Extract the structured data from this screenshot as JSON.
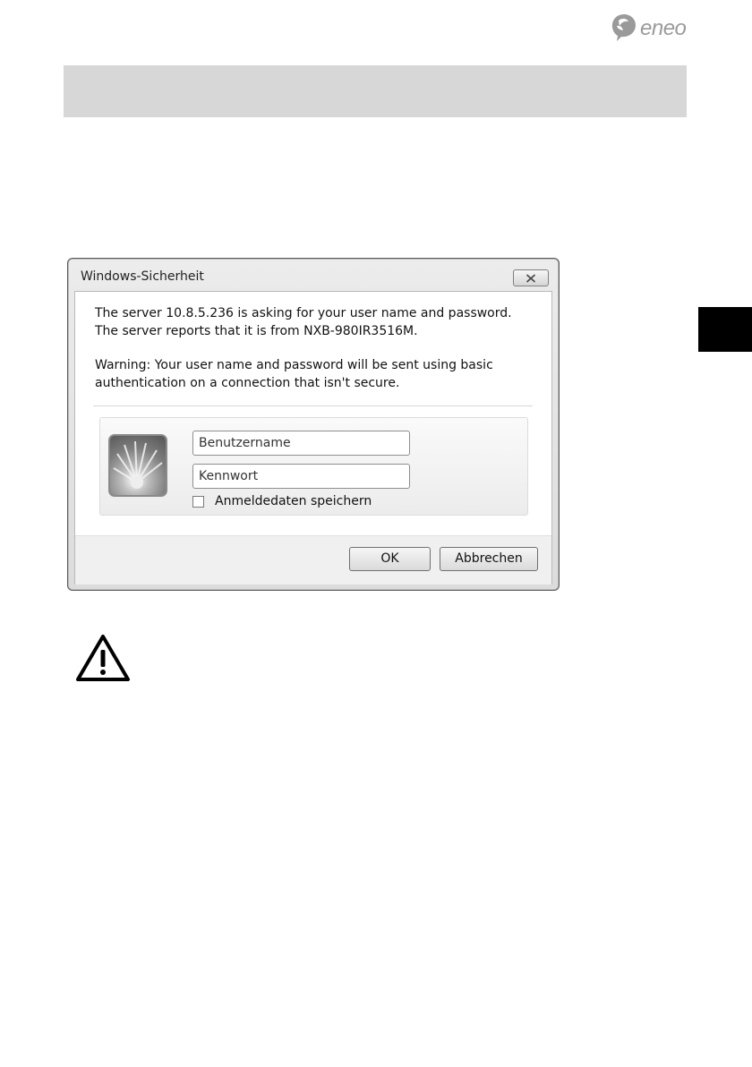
{
  "logo": {
    "text": "eneo"
  },
  "dialog": {
    "title": "Windows-Sicherheit",
    "message_line1": "The server 10.8.5.236 is asking for your user name and password. The server reports that it is from NXB-980IR3516M.",
    "message_line2": "Warning: Your user name and password will be sent using basic authentication on a connection that isn't secure.",
    "username_placeholder": "Benutzername",
    "password_placeholder": "Kennwort",
    "remember_label": "Anmeldedaten speichern",
    "ok_label": "OK",
    "cancel_label": "Abbrechen"
  },
  "icons": {
    "close": "close-icon",
    "avatar": "user-avatar-icon",
    "warning": "warning-icon",
    "logo": "eneo-logo-icon"
  },
  "colors": {
    "header_band": "#d7d7d7",
    "side_tab": "#000000",
    "logo": "#9a9a9a"
  }
}
